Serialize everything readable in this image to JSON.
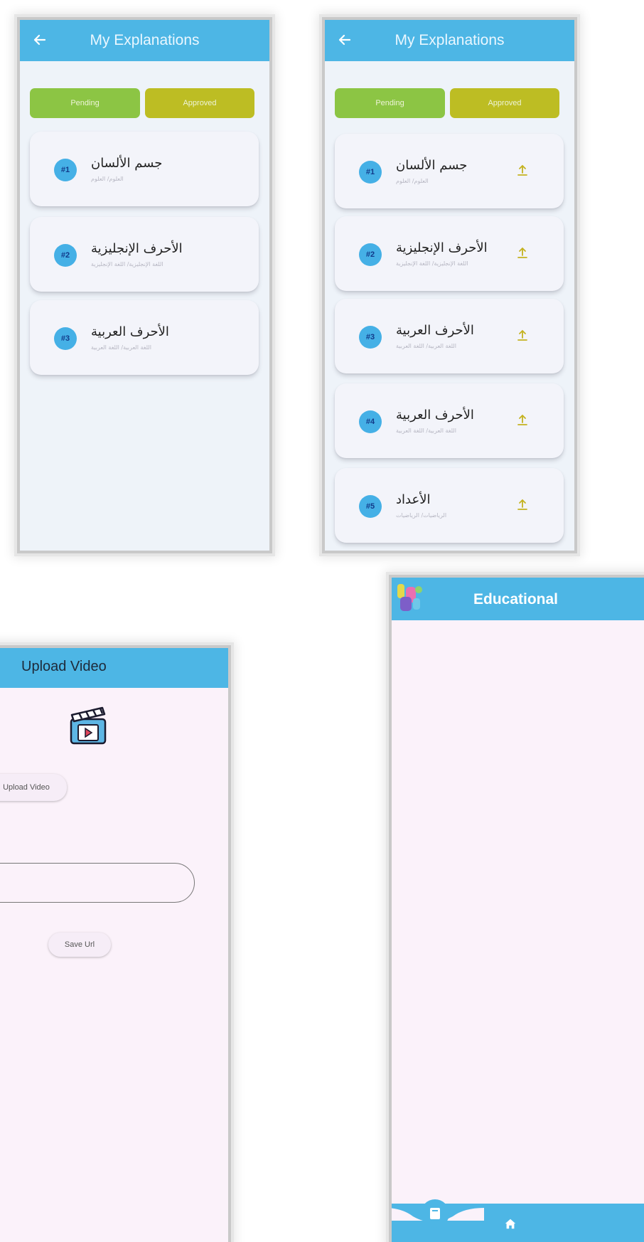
{
  "explanations": {
    "title": "My Explanations",
    "tabs": {
      "pending": "Pending",
      "approved": "Approved"
    }
  },
  "screen1": {
    "items": [
      {
        "num": "#1",
        "title": "جسم الألسان",
        "subtitle": "العلوم/ العلوم"
      },
      {
        "num": "#2",
        "title": "الأحرف الإنجليزية",
        "subtitle": "اللغة الإنجليزية/ اللغة الإنجليزية"
      },
      {
        "num": "#3",
        "title": "الأحرف العربية",
        "subtitle": "اللغة العربية/ اللغة العربية"
      }
    ]
  },
  "screen2": {
    "items": [
      {
        "num": "#1",
        "title": "جسم الألسان",
        "subtitle": "العلوم/ العلوم"
      },
      {
        "num": "#2",
        "title": "الأحرف الإنجليزية",
        "subtitle": "اللغة الإنجليزية/ اللغة الإنجليزية"
      },
      {
        "num": "#3",
        "title": "الأحرف العربية",
        "subtitle": "اللغة العربية/ اللغة العربية"
      },
      {
        "num": "#4",
        "title": "الأحرف العربية",
        "subtitle": "اللغة العربية/ اللغة العربية"
      },
      {
        "num": "#5",
        "title": "الأعداد",
        "subtitle": "الرياضيات/ الرياضيات"
      }
    ]
  },
  "upload": {
    "title": "Upload Video",
    "upload_button": "Upload Video",
    "url_value": "",
    "save_button": "Save Url",
    "icon": "video-clapperboard-icon"
  },
  "educational": {
    "title": "Educational",
    "nav": [
      "book-icon",
      "home-icon"
    ]
  },
  "colors": {
    "primary": "#4db6e5",
    "pending": "#8cc544",
    "approved": "#bdbd23",
    "number_badge": "#45b0e6",
    "upload_icon": "#c4b21f"
  }
}
